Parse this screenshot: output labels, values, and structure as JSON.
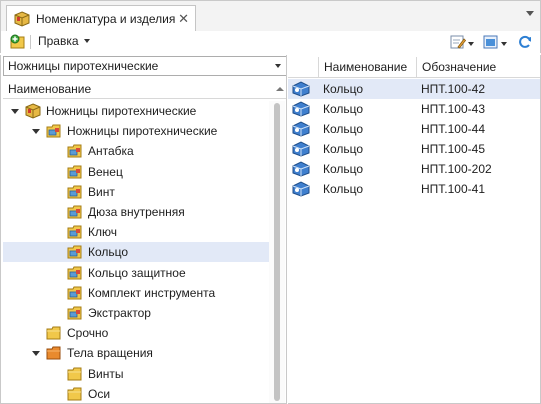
{
  "tab": {
    "title": "Номенклатура и изделия",
    "close_glyph": "✕"
  },
  "toolbar": {
    "menu_label": "Правка"
  },
  "left_pane": {
    "selector_value": "Ножницы пиротехнические",
    "column_header": "Наименование",
    "tree": [
      {
        "label": "Ножницы пиротехнические",
        "depth": 0,
        "expanded": true,
        "icon": "product-box-icon"
      },
      {
        "label": "Ножницы пиротехнические",
        "depth": 1,
        "expanded": true,
        "icon": "assembly-folder-icon"
      },
      {
        "label": "Антабка",
        "depth": 2,
        "icon": "assembly-folder-icon"
      },
      {
        "label": "Венец",
        "depth": 2,
        "icon": "assembly-folder-icon"
      },
      {
        "label": "Винт",
        "depth": 2,
        "icon": "assembly-folder-icon"
      },
      {
        "label": "Дюза внутренняя",
        "depth": 2,
        "icon": "assembly-folder-icon"
      },
      {
        "label": "Ключ",
        "depth": 2,
        "icon": "assembly-folder-icon"
      },
      {
        "label": "Кольцо",
        "depth": 2,
        "icon": "assembly-folder-icon",
        "selected": true
      },
      {
        "label": "Кольцо защитное",
        "depth": 2,
        "icon": "assembly-folder-icon"
      },
      {
        "label": "Комплект инструмента",
        "depth": 2,
        "icon": "assembly-folder-icon"
      },
      {
        "label": "Экстрактор",
        "depth": 2,
        "icon": "assembly-folder-icon"
      },
      {
        "label": "Срочно",
        "depth": 1,
        "icon": "folder-icon"
      },
      {
        "label": "Тела вращения",
        "depth": 1,
        "expanded": true,
        "icon": "orange-folder-icon"
      },
      {
        "label": "Винты",
        "depth": 2,
        "icon": "folder-icon"
      },
      {
        "label": "Оси",
        "depth": 2,
        "icon": "folder-icon"
      }
    ]
  },
  "right_pane": {
    "columns": [
      "Наименование",
      "Обозначение"
    ],
    "rows": [
      {
        "name": "Кольцо",
        "code": "НПТ.100-42",
        "selected": true
      },
      {
        "name": "Кольцо",
        "code": "НПТ.100-43"
      },
      {
        "name": "Кольцо",
        "code": "НПТ.100-44"
      },
      {
        "name": "Кольцо",
        "code": "НПТ.100-45"
      },
      {
        "name": "Кольцо",
        "code": "НПТ.100-202"
      },
      {
        "name": "Кольцо",
        "code": "НПТ.100-41"
      }
    ]
  },
  "colors": {
    "selection": "#e2e9f7",
    "border": "#c9c9c9",
    "folder_yellow": "#f1c84a",
    "folder_orange": "#e98a2e",
    "part_blue": "#3f7fce"
  }
}
